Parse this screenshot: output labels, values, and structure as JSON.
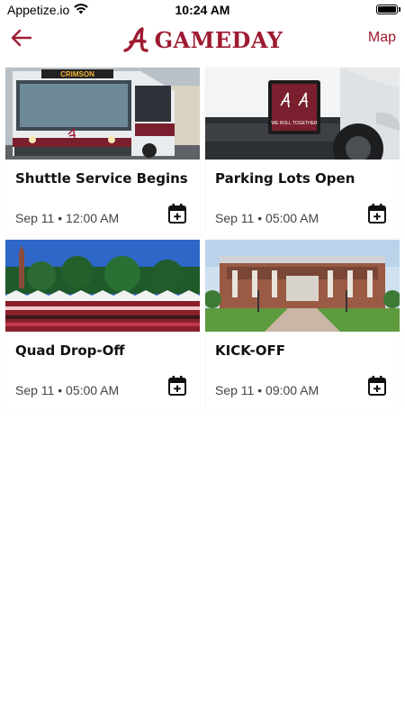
{
  "status": {
    "carrier": "Appetize.io",
    "time": "10:24 AM"
  },
  "nav": {
    "brand": "GAMEDAY",
    "brand_color": "#9e1b32",
    "map_label": "Map",
    "back_icon": "arrow-left-icon"
  },
  "events": [
    {
      "title": "Shuttle Service Begins",
      "date": "Sep 11",
      "time": "12:00 AM",
      "image": "shuttle-bus-photo"
    },
    {
      "title": "Parking Lots Open",
      "date": "Sep 11",
      "time": "05:00 AM",
      "image": "license-plate-photo"
    },
    {
      "title": "Quad Drop-Off",
      "date": "Sep 11",
      "time": "05:00 AM",
      "image": "quad-crowd-photo"
    },
    {
      "title": "KICK-OFF",
      "date": "Sep 11",
      "time": "09:00 AM",
      "image": "stadium-photo"
    }
  ],
  "bus_sign": "CRIMSON",
  "plate_text": "WE ROLL TOGETHER",
  "separator": "•"
}
